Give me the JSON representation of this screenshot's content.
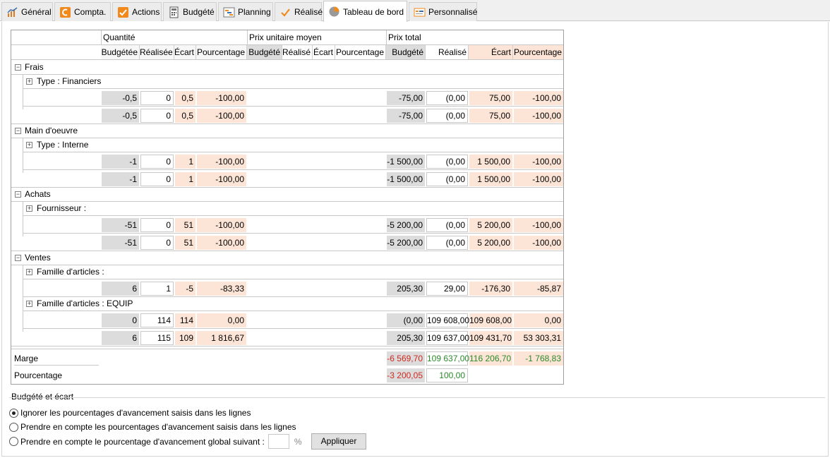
{
  "tabs": [
    {
      "label": "Général",
      "icon": "chart-icon"
    },
    {
      "label": "Compta.",
      "icon": "compta-icon"
    },
    {
      "label": "Actions",
      "icon": "check-icon"
    },
    {
      "label": "Budgété",
      "icon": "calculator-icon"
    },
    {
      "label": "Planning",
      "icon": "planning-icon"
    },
    {
      "label": "Réalisé",
      "icon": "checkmark-icon"
    },
    {
      "label": "Tableau de bord",
      "icon": "pie-chart-icon",
      "active": true
    },
    {
      "label": "Personnalisé",
      "icon": "custom-icon"
    }
  ],
  "grid": {
    "groups": [
      "Quantité",
      "Prix unitaire moyen",
      "Prix total"
    ],
    "q_cols": [
      "Budgétée",
      "Réalisée",
      "Écart",
      "Pourcentage"
    ],
    "p_cols": [
      "Budgété",
      "Réalisé",
      "Écart",
      "Pourcentage"
    ],
    "t_cols": [
      "Budgété",
      "Réalisé",
      "Écart",
      "Pourcentage"
    ],
    "sections": [
      {
        "label": "Frais",
        "subs": [
          {
            "label": "Type : Financiers",
            "q": [
              "-0,5",
              "0",
              "0,5",
              "-100,00"
            ],
            "t": [
              "-75,00",
              "(0,00",
              "75,00",
              "-100,00"
            ]
          }
        ],
        "total": {
          "q": [
            "-0,5",
            "0",
            "0,5",
            "-100,00"
          ],
          "t": [
            "-75,00",
            "(0,00",
            "75,00",
            "-100,00"
          ]
        }
      },
      {
        "label": "Main d'oeuvre",
        "subs": [
          {
            "label": "Type : Interne",
            "q": [
              "-1",
              "0",
              "1",
              "-100,00"
            ],
            "t": [
              "-1 500,00",
              "(0,00",
              "1 500,00",
              "-100,00"
            ]
          }
        ],
        "total": {
          "q": [
            "-1",
            "0",
            "1",
            "-100,00"
          ],
          "t": [
            "-1 500,00",
            "(0,00",
            "1 500,00",
            "-100,00"
          ]
        }
      },
      {
        "label": "Achats",
        "subs": [
          {
            "label": "Fournisseur :",
            "q": [
              "-51",
              "0",
              "51",
              "-100,00"
            ],
            "t": [
              "-5 200,00",
              "(0,00",
              "5 200,00",
              "-100,00"
            ]
          }
        ],
        "total": {
          "q": [
            "-51",
            "0",
            "51",
            "-100,00"
          ],
          "t": [
            "-5 200,00",
            "(0,00",
            "5 200,00",
            "-100,00"
          ]
        }
      },
      {
        "label": "Ventes",
        "subs": [
          {
            "label": "Famille d'articles :",
            "q": [
              "6",
              "1",
              "-5",
              "-83,33"
            ],
            "t": [
              "205,30",
              "29,00",
              "-176,30",
              "-85,87"
            ]
          },
          {
            "label": "Famille d'articles : EQUIP",
            "q": [
              "0",
              "114",
              "114",
              "0,00"
            ],
            "t": [
              "(0,00",
              "109 608,00",
              "109 608,00",
              "0,00"
            ]
          }
        ],
        "total": {
          "q": [
            "6",
            "115",
            "109",
            "1 816,67"
          ],
          "t": [
            "205,30",
            "109 637,00",
            "109 431,70",
            "53 303,31"
          ]
        }
      }
    ],
    "marge": {
      "label": "Marge",
      "values": [
        "-6 569,70",
        "109 637,00",
        "116 206,70",
        "-1 768,83"
      ]
    },
    "pourcentage": {
      "label": "Pourcentage",
      "values": [
        "-3 200,05",
        "100,00"
      ]
    },
    "colors": {
      "grey": "#dcdcdc",
      "salmon": "#fce4d6",
      "red": "#d0281e",
      "green": "#2a8a2a"
    }
  },
  "options": {
    "title": "Budgété et écart",
    "radios": [
      {
        "label": "Ignorer les pourcentages d'avancement saisis dans les lignes",
        "checked": true
      },
      {
        "label": "Prendre en compte les pourcentages d'avancement saisis dans les lignes",
        "checked": false
      },
      {
        "label": "Prendre en compte le pourcentage d'avancement global suivant :",
        "checked": false
      }
    ],
    "percent_sign": "%",
    "apply_label": "Appliquer"
  }
}
